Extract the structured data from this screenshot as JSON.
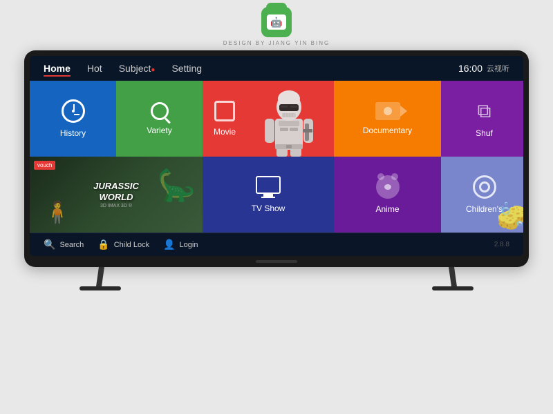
{
  "branding": {
    "logo_alt": "Cloud TV Logo",
    "designer_text": "DESIGN BY JIANG YIN BING"
  },
  "nav": {
    "items": [
      {
        "label": "Home",
        "active": true,
        "id": "home"
      },
      {
        "label": "Hot",
        "active": false,
        "id": "hot"
      },
      {
        "label": "Subject",
        "active": false,
        "id": "subject",
        "dot": true
      },
      {
        "label": "Setting",
        "active": false,
        "id": "setting"
      }
    ],
    "time": "16:00",
    "tv_brand": "云视听"
  },
  "grid": {
    "row1": [
      {
        "id": "history",
        "label": "History",
        "color": "#1565C0",
        "icon": "clock"
      },
      {
        "id": "variety",
        "label": "Variety",
        "color": "#43A047",
        "icon": "magnifier"
      },
      {
        "id": "movie",
        "label": "Movie",
        "color": "#E53935",
        "icon": "film"
      },
      {
        "id": "documentary",
        "label": "Documentary",
        "color": "#F57C00",
        "icon": "video-camera"
      },
      {
        "id": "shuffle",
        "label": "Shuf",
        "color": "#7B1FA2",
        "icon": "shuffle"
      }
    ],
    "row2": [
      {
        "id": "voucher",
        "label": "Jurassic World",
        "badge": "vouch",
        "color": "#1a2a3a"
      },
      {
        "id": "tvshow",
        "label": "TV Show",
        "color": "#283593",
        "icon": "tv"
      },
      {
        "id": "anime",
        "label": "Anime",
        "color": "#6A1B9A",
        "icon": "bear"
      },
      {
        "id": "children",
        "label": "Children's",
        "color": "#7986CB",
        "icon": "spiral"
      }
    ]
  },
  "bottom_bar": {
    "buttons": [
      {
        "id": "search",
        "label": "Search",
        "icon": "search"
      },
      {
        "id": "childlock",
        "label": "Child Lock",
        "icon": "lock"
      },
      {
        "id": "login",
        "label": "Login",
        "icon": "person"
      }
    ],
    "version": "2.8.8"
  },
  "jurassic": {
    "title": "JURASSIC\nWORLD",
    "subtitle": "3D IMAX 3D ®"
  }
}
